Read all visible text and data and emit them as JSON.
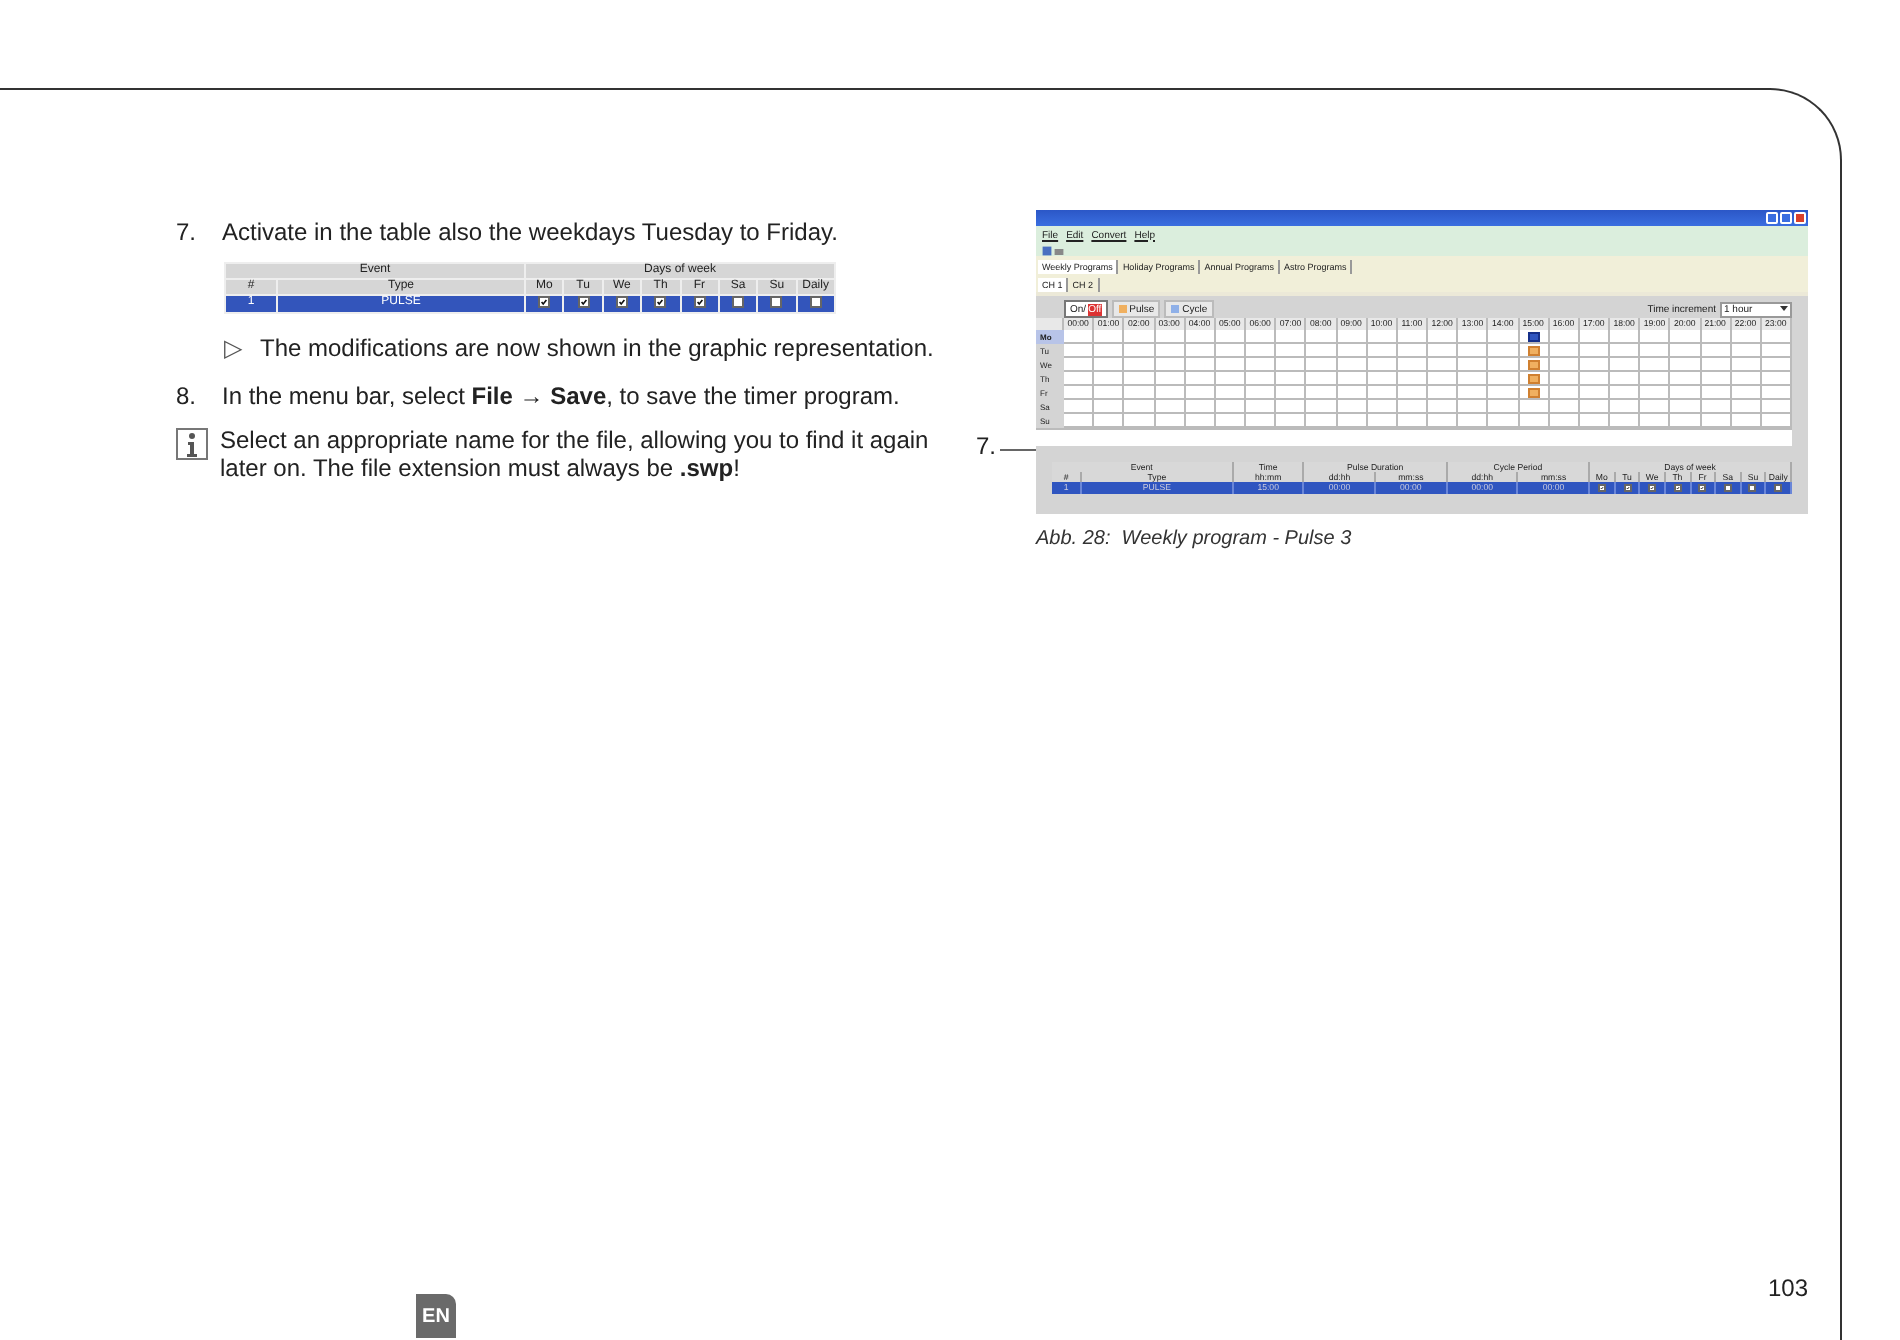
{
  "steps": [
    {
      "number": "7.",
      "text": "Activate in the table also the weekdays Tuesday to Friday."
    },
    {
      "number": "8.",
      "text": "In the menu bar, select **File** → **Save**, to save the timer program."
    }
  ],
  "small_table": {
    "group_headers": [
      "Event",
      "Days of week"
    ],
    "columns": [
      "#",
      "Type",
      "Mo",
      "Tu",
      "We",
      "Th",
      "Fr",
      "Sa",
      "Su",
      "Daily"
    ],
    "rows": [
      {
        "number": "1",
        "type": "PULSE",
        "selected": true,
        "days": [
          {
            "checked": true
          },
          {
            "checked": true
          },
          {
            "checked": true
          },
          {
            "checked": true
          },
          {
            "checked": true
          },
          {
            "checked": false
          },
          {
            "checked": false
          },
          {
            "checked": false
          }
        ]
      }
    ]
  },
  "result": {
    "marker": "▷",
    "text": "The modifications are now shown in the graphic representation."
  },
  "info": {
    "text": "Select an appropriate name for the file, allowing you to find it again later on. The file extension must always be **.swp**!"
  },
  "figure": {
    "callout": "7.",
    "caption": "Abb. 28:  Weekly program - Pulse 3",
    "window": {
      "menu": [
        "File",
        "Edit",
        "Convert",
        "Help"
      ],
      "tabs": [
        {
          "label": "Weekly Programs",
          "selected": true
        },
        {
          "label": "Holiday Programs",
          "selected": false
        },
        {
          "label": "Annual Programs",
          "selected": false
        },
        {
          "label": "Astro Programs",
          "selected": false
        }
      ],
      "channels": [
        {
          "label": "CH 1",
          "selected": true
        },
        {
          "label": "CH 2",
          "selected": false
        }
      ],
      "modes": [
        {
          "kind": "onoff",
          "label": "On/",
          "label_highlight": "Off",
          "selected": true
        },
        {
          "kind": "pulse",
          "label": "Pulse",
          "selected": false
        },
        {
          "kind": "cycle",
          "label": "Cycle",
          "selected": false
        }
      ],
      "time_increment": {
        "label": "Time increment",
        "value": "1 hour"
      },
      "hours": [
        {
          "label": "00:00"
        },
        {
          "label": "01:00"
        },
        {
          "label": "02:00"
        },
        {
          "label": "03:00"
        },
        {
          "label": "04:00"
        },
        {
          "label": "05:00"
        },
        {
          "label": "06:00"
        },
        {
          "label": "07:00"
        },
        {
          "label": "08:00"
        },
        {
          "label": "09:00"
        },
        {
          "label": "10:00"
        },
        {
          "label": "11:00"
        },
        {
          "label": "12:00"
        },
        {
          "label": "13:00"
        },
        {
          "label": "14:00"
        },
        {
          "label": "15:00",
          "has_pulses": true
        },
        {
          "label": "16:00"
        },
        {
          "label": "17:00"
        },
        {
          "label": "18:00"
        },
        {
          "label": "19:00"
        },
        {
          "label": "20:00"
        },
        {
          "label": "21:00"
        },
        {
          "label": "22:00"
        },
        {
          "label": "23:00"
        }
      ],
      "days": [
        {
          "label": "Mo",
          "pulse": true,
          "selected": true
        },
        {
          "label": "Tu",
          "pulse": true,
          "selected": false
        },
        {
          "label": "We",
          "pulse": true,
          "selected": false
        },
        {
          "label": "Th",
          "pulse": true,
          "selected": false
        },
        {
          "label": "Fr",
          "pulse": true,
          "selected": false
        },
        {
          "label": "Sa",
          "pulse": false,
          "selected": false
        },
        {
          "label": "Su",
          "pulse": false,
          "selected": false
        }
      ],
      "table": {
        "group_headers": [
          "Event",
          "Time",
          "Pulse Duration",
          "Cycle Period",
          "Days of week"
        ],
        "columns": [
          "#",
          "Type",
          "hh:mm",
          "dd:hh",
          "mm:ss",
          "dd:hh",
          "mm:ss",
          "Mo",
          "Tu",
          "We",
          "Th",
          "Fr",
          "Sa",
          "Su",
          "Daily"
        ],
        "rows": [
          {
            "number": "1",
            "type": "PULSE",
            "time": "15:00",
            "pulse_duration": [
              "00:00",
              "00:00"
            ],
            "cycle_period": [
              "00:00",
              "00:00"
            ],
            "selected": true,
            "days": [
              {
                "checked": true
              },
              {
                "checked": true
              },
              {
                "checked": true
              },
              {
                "checked": true
              },
              {
                "checked": true
              },
              {
                "checked": false
              },
              {
                "checked": false
              },
              {
                "checked": false
              }
            ]
          }
        ]
      }
    }
  },
  "footer": {
    "language": "EN",
    "page_number": "103"
  }
}
